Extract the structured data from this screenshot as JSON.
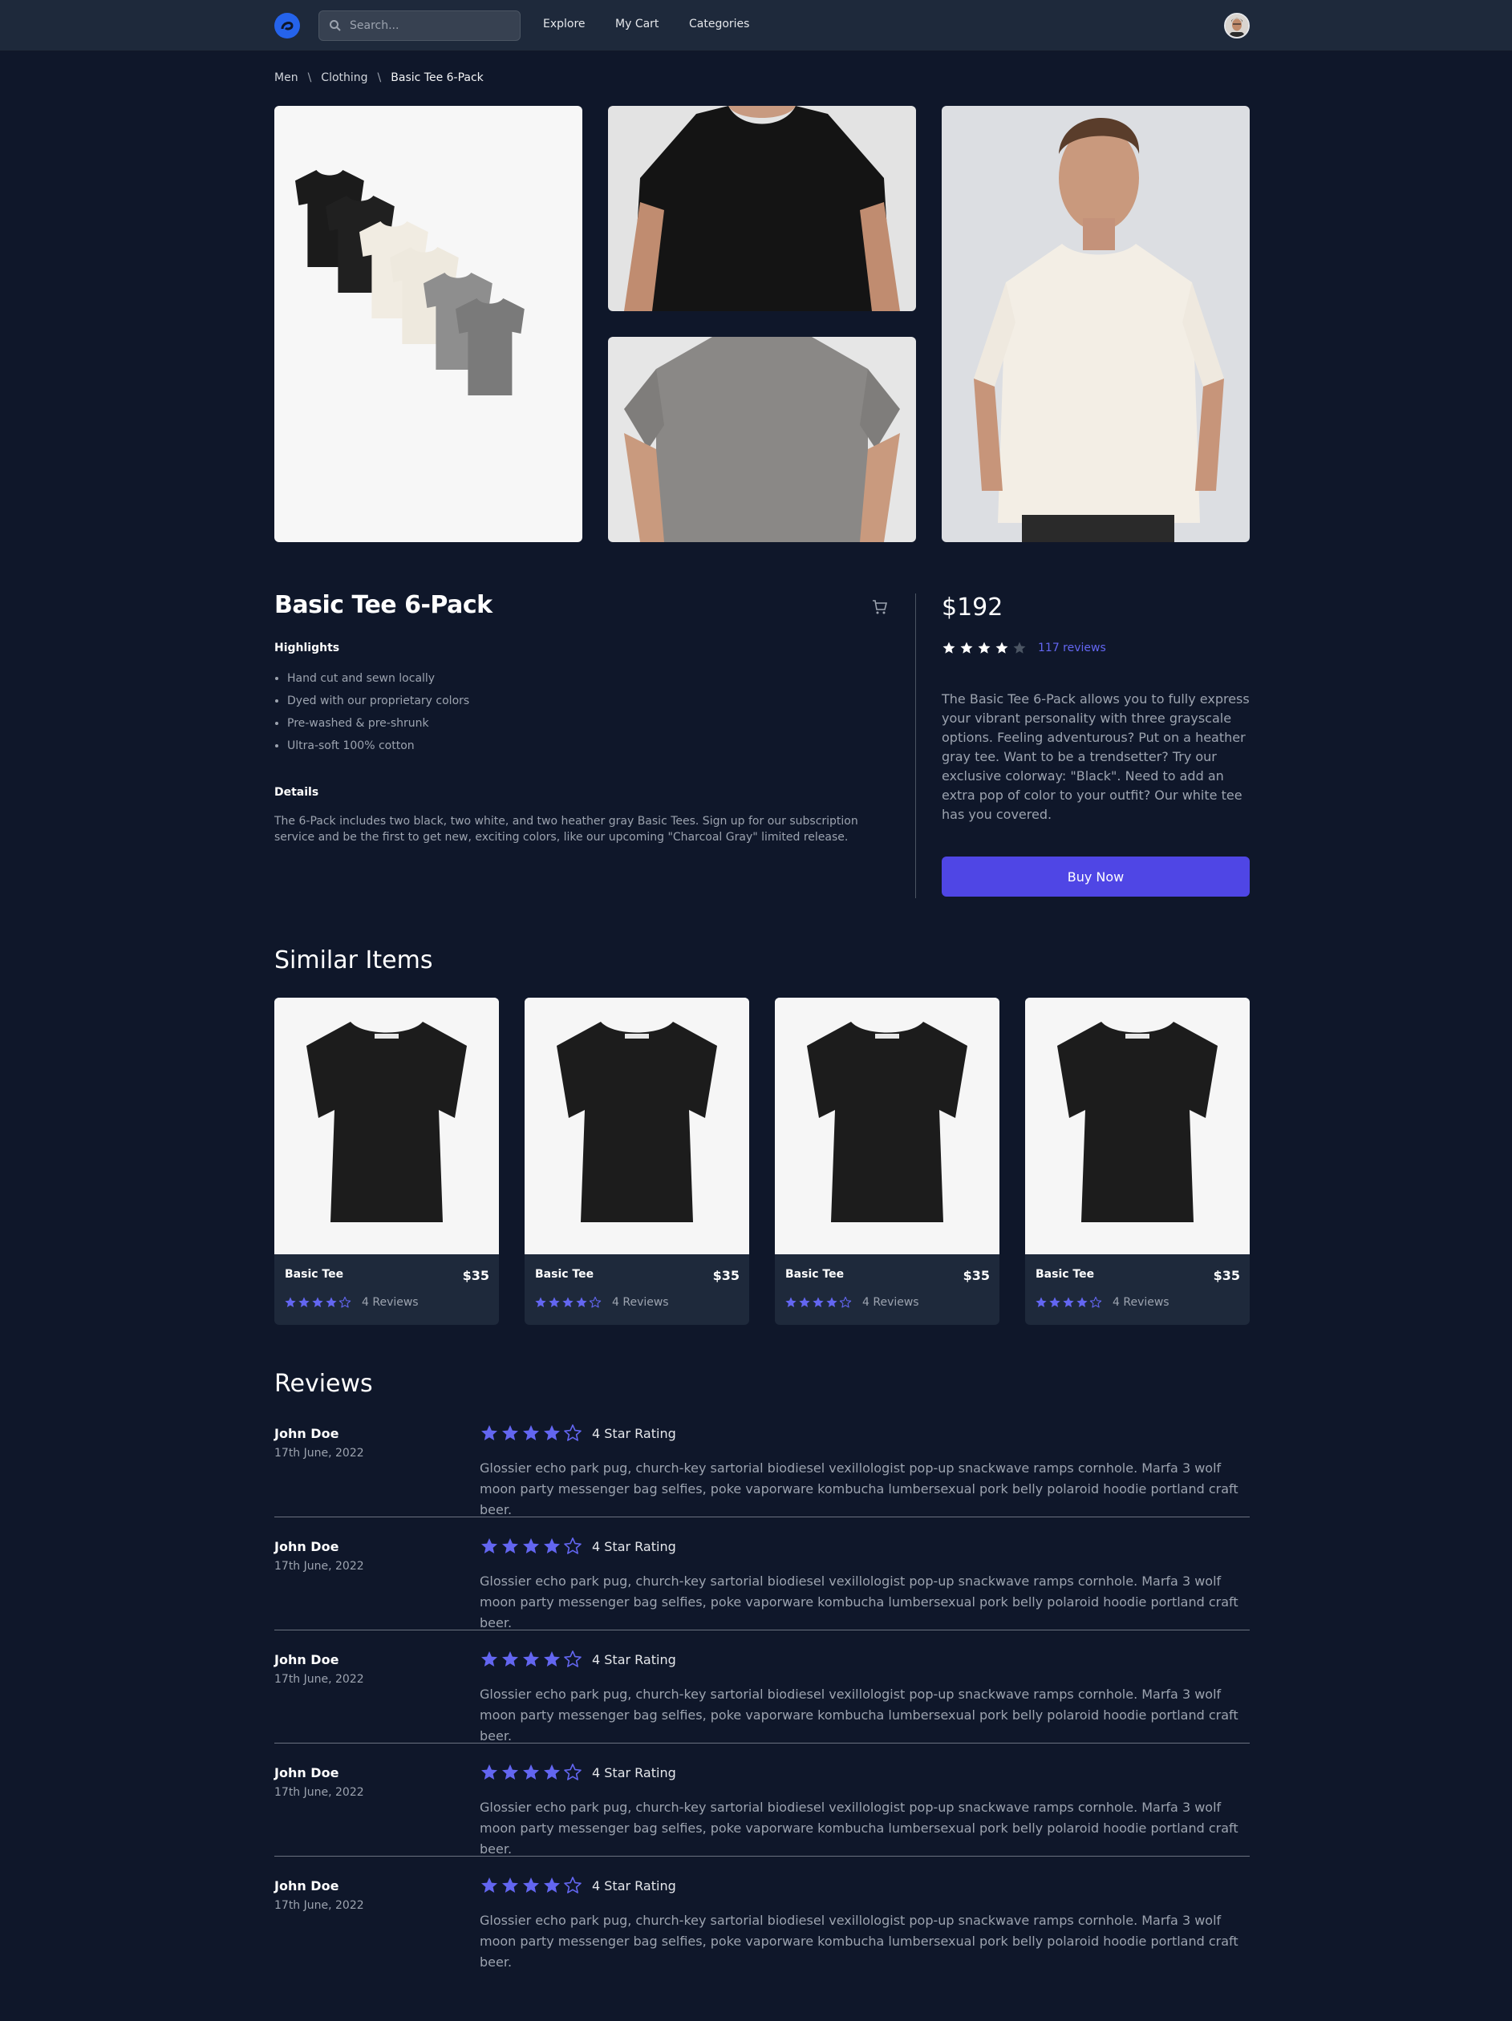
{
  "nav": {
    "search_placeholder": "Search...",
    "links": [
      "Explore",
      "My Cart",
      "Categories"
    ]
  },
  "breadcrumb": [
    "Men",
    "Clothing",
    "Basic Tee 6-Pack"
  ],
  "breadcrumb_separator": "\\",
  "product": {
    "title": "Basic Tee 6-Pack",
    "highlights_heading": "Highlights",
    "highlights": [
      "Hand cut and sewn locally",
      "Dyed with our proprietary colors",
      "Pre-washed & pre-shrunk",
      "Ultra-soft 100% cotton"
    ],
    "details_heading": "Details",
    "details": "The 6-Pack includes two black, two white, and two heather gray Basic Tees. Sign up for our subscription service and be the first to get new, exciting colors, like our upcoming \"Charcoal Gray\" limited release.",
    "price": "$192",
    "rating": 4,
    "reviews_link": "117 reviews",
    "description": "The Basic Tee 6-Pack allows you to fully express your vibrant personality with three grayscale options. Feeling adventurous? Put on a heather gray tee. Want to be a trendsetter? Try our exclusive colorway: \"Black\". Need to add an extra pop of color to your outfit? Our white tee has you covered.",
    "buy_label": "Buy Now"
  },
  "similar": {
    "title": "Similar Items",
    "items": [
      {
        "name": "Basic Tee",
        "price": "$35",
        "rating": 4,
        "reviews": "4 Reviews"
      },
      {
        "name": "Basic Tee",
        "price": "$35",
        "rating": 4,
        "reviews": "4 Reviews"
      },
      {
        "name": "Basic Tee",
        "price": "$35",
        "rating": 4,
        "reviews": "4 Reviews"
      },
      {
        "name": "Basic Tee",
        "price": "$35",
        "rating": 4,
        "reviews": "4 Reviews"
      }
    ]
  },
  "reviews": {
    "title": "Reviews",
    "items": [
      {
        "name": "John Doe",
        "date": "17th June, 2022",
        "rating": 4,
        "rating_label": "4 Star Rating",
        "text": "Glossier echo park pug, church-key sartorial biodiesel vexillologist pop-up snackwave ramps cornhole. Marfa 3 wolf moon party messenger bag selfies, poke vaporware kombucha lumbersexual pork belly polaroid hoodie portland craft beer."
      },
      {
        "name": "John Doe",
        "date": "17th June, 2022",
        "rating": 4,
        "rating_label": "4 Star Rating",
        "text": "Glossier echo park pug, church-key sartorial biodiesel vexillologist pop-up snackwave ramps cornhole. Marfa 3 wolf moon party messenger bag selfies, poke vaporware kombucha lumbersexual pork belly polaroid hoodie portland craft beer."
      },
      {
        "name": "John Doe",
        "date": "17th June, 2022",
        "rating": 4,
        "rating_label": "4 Star Rating",
        "text": "Glossier echo park pug, church-key sartorial biodiesel vexillologist pop-up snackwave ramps cornhole. Marfa 3 wolf moon party messenger bag selfies, poke vaporware kombucha lumbersexual pork belly polaroid hoodie portland craft beer."
      },
      {
        "name": "John Doe",
        "date": "17th June, 2022",
        "rating": 4,
        "rating_label": "4 Star Rating",
        "text": "Glossier echo park pug, church-key sartorial biodiesel vexillologist pop-up snackwave ramps cornhole. Marfa 3 wolf moon party messenger bag selfies, poke vaporware kombucha lumbersexual pork belly polaroid hoodie portland craft beer."
      },
      {
        "name": "John Doe",
        "date": "17th June, 2022",
        "rating": 4,
        "rating_label": "4 Star Rating",
        "text": "Glossier echo park pug, church-key sartorial biodiesel vexillologist pop-up snackwave ramps cornhole. Marfa 3 wolf moon party messenger bag selfies, poke vaporware kombucha lumbersexual pork belly polaroid hoodie portland craft beer."
      }
    ]
  },
  "colors": {
    "background": "#0f172a",
    "nav": "#1e293b",
    "accent": "#4f46e5",
    "star_filled": "#6366f1"
  }
}
